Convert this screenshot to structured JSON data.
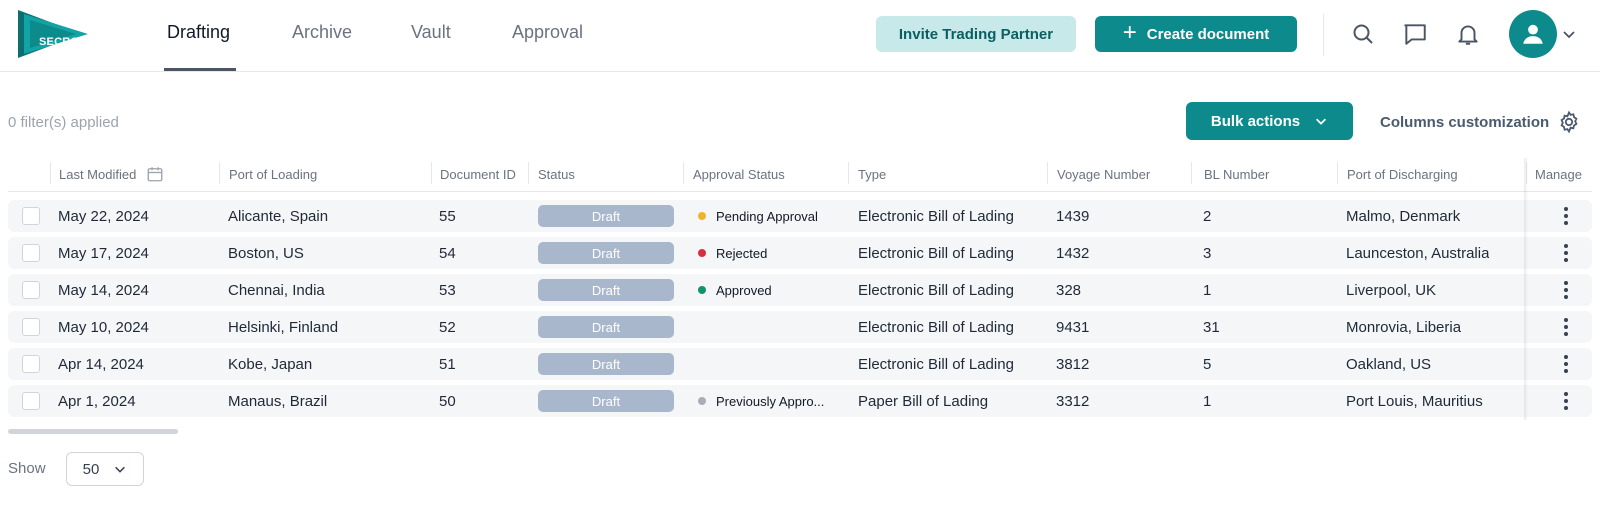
{
  "brand": {
    "logo_text": "SECRO",
    "accent": "#0d8a8c",
    "accent_light": "#c8e9ea"
  },
  "nav": {
    "tabs": [
      {
        "label": "Drafting",
        "active": true
      },
      {
        "label": "Archive",
        "active": false
      },
      {
        "label": "Vault",
        "active": false
      },
      {
        "label": "Approval",
        "active": false
      }
    ],
    "invite_label": "Invite Trading Partner",
    "create_label": "Create document",
    "icons": [
      "search-icon",
      "chat-icon",
      "bell-icon",
      "user-avatar-icon",
      "chevron-down-icon"
    ]
  },
  "toolbar": {
    "filters_text": "0 filter(s) applied",
    "bulk_label": "Bulk actions",
    "columns_label": "Columns customization"
  },
  "table": {
    "headers": {
      "last_modified": "Last Modified",
      "port_loading": "Port of Loading",
      "document_id": "Document ID",
      "status": "Status",
      "approval_status": "Approval Status",
      "type": "Type",
      "voyage_number": "Voyage Number",
      "bl_number": "BL Number",
      "port_discharging": "Port of Discharging",
      "manage": "Manage"
    },
    "rows": [
      {
        "date": "May 22, 2024",
        "pol": "Alicante, Spain",
        "id": "55",
        "status": "Draft",
        "approval": "Pending Approval",
        "approval_color": "#f0b429",
        "type": "Electronic Bill of Lading",
        "voyage": "1439",
        "bl": "2",
        "pod": "Malmo, Denmark"
      },
      {
        "date": "May 17, 2024",
        "pol": "Boston, US",
        "id": "54",
        "status": "Draft",
        "approval": "Rejected",
        "approval_color": "#d63040",
        "type": "Electronic Bill of Lading",
        "voyage": "1432",
        "bl": "3",
        "pod": "Launceston, Australia"
      },
      {
        "date": "May 14, 2024",
        "pol": "Chennai, India",
        "id": "53",
        "status": "Draft",
        "approval": "Approved",
        "approval_color": "#12946a",
        "type": "Electronic Bill of Lading",
        "voyage": "328",
        "bl": "1",
        "pod": "Liverpool, UK"
      },
      {
        "date": "May 10, 2024",
        "pol": "Helsinki, Finland",
        "id": "52",
        "status": "Draft",
        "approval": "",
        "approval_color": "",
        "type": "Electronic Bill of Lading",
        "voyage": "9431",
        "bl": "31",
        "pod": "Monrovia, Liberia"
      },
      {
        "date": "Apr 14, 2024",
        "pol": "Kobe, Japan",
        "id": "51",
        "status": "Draft",
        "approval": "",
        "approval_color": "",
        "type": "Electronic Bill of Lading",
        "voyage": "3812",
        "bl": "5",
        "pod": "Oakland, US"
      },
      {
        "date": "Apr 1, 2024",
        "pol": "Manaus, Brazil",
        "id": "50",
        "status": "Draft",
        "approval": "Previously Appro...",
        "approval_color": "#a9adb5",
        "type": "Paper Bill of Lading",
        "voyage": "3312",
        "bl": "1",
        "pod": "Port Louis, Mauritius"
      }
    ]
  },
  "pagination": {
    "show_label": "Show",
    "page_size": "50"
  }
}
